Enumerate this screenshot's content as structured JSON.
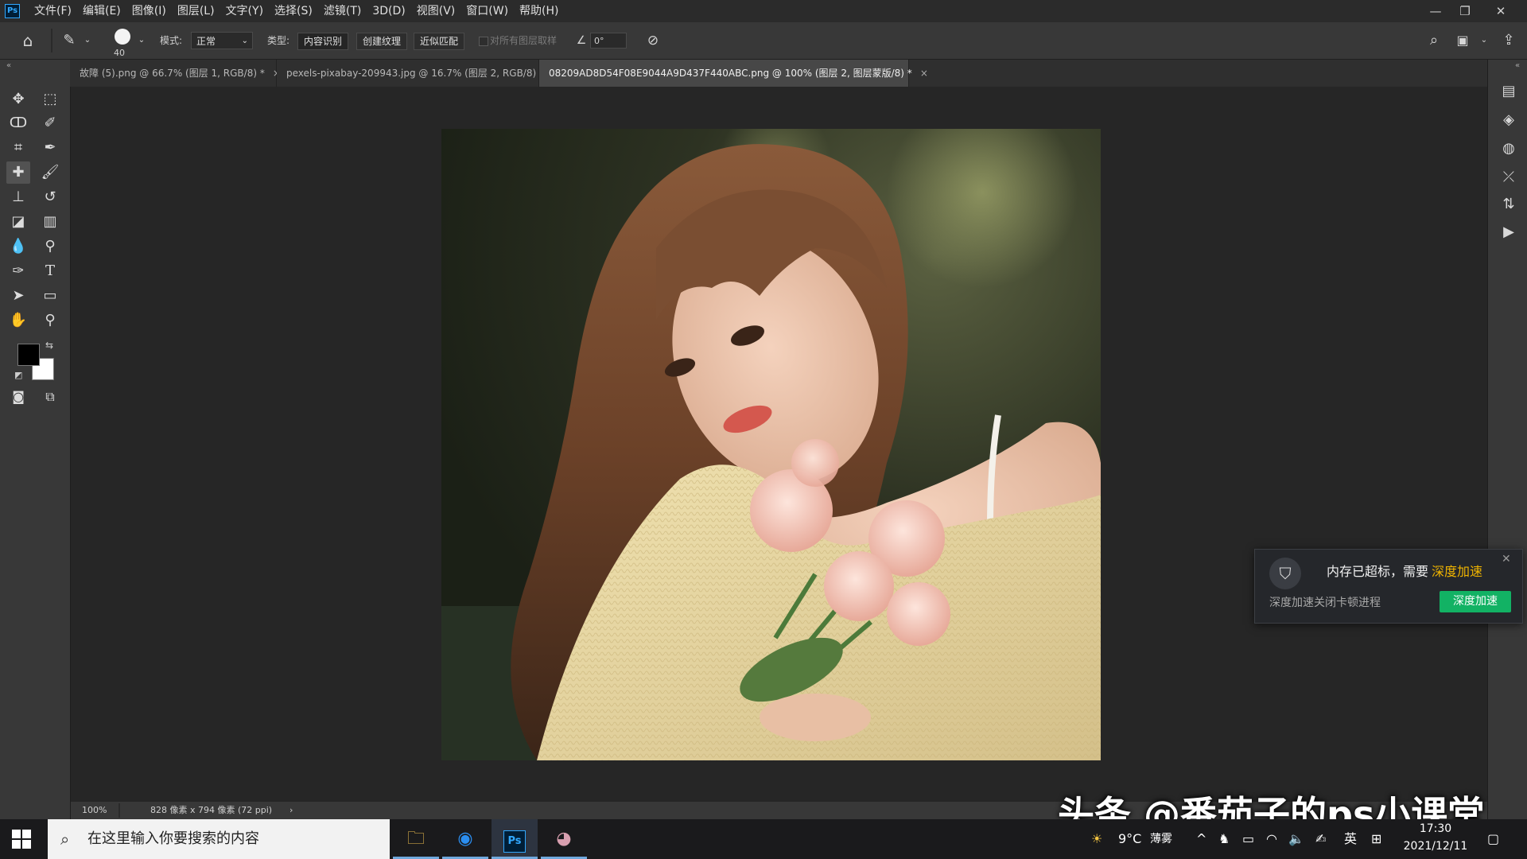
{
  "app": {
    "logo": "Ps"
  },
  "menu": [
    "文件(F)",
    "编辑(E)",
    "图像(I)",
    "图层(L)",
    "文字(Y)",
    "选择(S)",
    "滤镜(T)",
    "3D(D)",
    "视图(V)",
    "窗口(W)",
    "帮助(H)"
  ],
  "window_controls": {
    "minimize": "—",
    "restore": "❐",
    "close": "✕"
  },
  "options": {
    "brush_size": "40",
    "mode_label": "模式:",
    "mode_value": "正常",
    "type_label": "类型:",
    "type_buttons": [
      "内容识别",
      "创建纹理",
      "近似匹配"
    ],
    "sample_all_layers": "对所有图层取样",
    "angle_value": "0°"
  },
  "tabs": [
    {
      "label": "故障 (5).png @ 66.7% (图层 1, RGB/8) *",
      "active": false
    },
    {
      "label": "pexels-pixabay-209943.jpg @ 16.7% (图层 2, RGB/8) *",
      "active": false
    },
    {
      "label": "08209AD8D54F08E9044A9D437F440ABC.png @ 100% (图层 2, 图层蒙版/8) *",
      "active": true
    }
  ],
  "tab_close": "×",
  "status": {
    "zoom": "100%",
    "doc_info": "828 像素 x 794 像素 (72 ppi)",
    "arrow": "›"
  },
  "popup": {
    "message": "内存已超标，需要",
    "highlight": "深度加速",
    "subtext": "深度加速关闭卡顿进程",
    "button": "深度加速",
    "close": "✕"
  },
  "taskbar": {
    "search_placeholder": "在这里输入你要搜索的内容",
    "weather_temp": "9°C",
    "weather_desc": "薄雾",
    "lang": "英",
    "time": "17:30",
    "date": "2021/12/11"
  },
  "watermark": "头条 @番茄子的ps小课堂",
  "colors": {
    "accent_green": "#12b264",
    "highlight_yellow": "#f0b400",
    "ps_blue": "#31a8ff"
  }
}
